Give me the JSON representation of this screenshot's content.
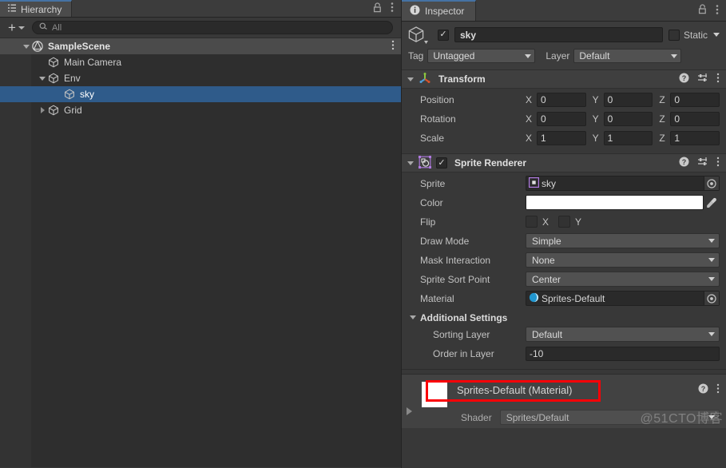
{
  "hierarchy": {
    "tab_label": "Hierarchy",
    "tab_icon": "hierarchy-icon",
    "lock_icon": "lock-icon",
    "menu_icon": "kebab-menu-icon",
    "create_label": "+",
    "search_placeholder": "All",
    "search_icon": "search-icon",
    "tree": [
      {
        "label": "SampleScene",
        "icon": "unity-scene-icon",
        "depth": 0,
        "expander": "down",
        "selected": false,
        "is_scene": true,
        "menu_icon": "kebab-menu-icon"
      },
      {
        "label": "Main Camera",
        "icon": "gameobject-cube-icon",
        "depth": 1,
        "expander": "none",
        "selected": false,
        "is_scene": false
      },
      {
        "label": "Env",
        "icon": "gameobject-cube-icon",
        "depth": 1,
        "expander": "down",
        "selected": false,
        "is_scene": false
      },
      {
        "label": "sky",
        "icon": "gameobject-cube-icon",
        "depth": 2,
        "expander": "none",
        "selected": true,
        "is_scene": false
      },
      {
        "label": "Grid",
        "icon": "gameobject-cube-icon",
        "depth": 1,
        "expander": "right",
        "selected": false,
        "is_scene": false
      }
    ]
  },
  "inspector": {
    "tab_label": "Inspector",
    "tab_icon": "info-circle-icon",
    "lock_icon": "lock-icon",
    "menu_icon": "kebab-menu-icon",
    "object": {
      "icon": "gameobject-cube-icon",
      "enabled": true,
      "name": "sky",
      "static_checked": false,
      "static_label": "Static",
      "tag_label": "Tag",
      "tag_value": "Untagged",
      "layer_label": "Layer",
      "layer_value": "Default"
    },
    "components": [
      {
        "title": "Transform",
        "icon": "transform-gizmo-icon",
        "expanded": true,
        "has_checkbox": false,
        "help_icon": "help-icon",
        "preset_icon": "preset-icon",
        "menu_icon": "kebab-menu-icon",
        "rows": [
          {
            "label": "Position",
            "axes": [
              {
                "axis": "X",
                "value": "0"
              },
              {
                "axis": "Y",
                "value": "0"
              },
              {
                "axis": "Z",
                "value": "0"
              }
            ]
          },
          {
            "label": "Rotation",
            "axes": [
              {
                "axis": "X",
                "value": "0"
              },
              {
                "axis": "Y",
                "value": "0"
              },
              {
                "axis": "Z",
                "value": "0"
              }
            ]
          },
          {
            "label": "Scale",
            "axes": [
              {
                "axis": "X",
                "value": "1"
              },
              {
                "axis": "Y",
                "value": "1"
              },
              {
                "axis": "Z",
                "value": "1"
              }
            ]
          }
        ]
      },
      {
        "title": "Sprite Renderer",
        "icon": "sprite-renderer-icon",
        "expanded": true,
        "has_checkbox": true,
        "checked": true,
        "help_icon": "help-icon",
        "preset_icon": "preset-icon",
        "menu_icon": "kebab-menu-icon"
      }
    ],
    "sprite_renderer": {
      "sprite_label": "Sprite",
      "sprite_value": "sky",
      "sprite_icon": "sprite-asset-icon",
      "color_label": "Color",
      "color_value": "#FFFFFF",
      "eyedropper_icon": "eyedropper-icon",
      "flip_label": "Flip",
      "flip_x_label": "X",
      "flip_y_label": "Y",
      "flip_x_checked": false,
      "flip_y_checked": false,
      "draw_mode_label": "Draw Mode",
      "draw_mode_value": "Simple",
      "mask_interaction_label": "Mask Interaction",
      "mask_interaction_value": "None",
      "sort_point_label": "Sprite Sort Point",
      "sort_point_value": "Center",
      "material_label": "Material",
      "material_value": "Sprites-Default",
      "material_icon": "material-sphere-icon",
      "additional_settings_label": "Additional Settings",
      "sorting_layer_label": "Sorting Layer",
      "sorting_layer_value": "Default",
      "order_in_layer_label": "Order in Layer",
      "order_in_layer_value": "-10"
    },
    "material_preview": {
      "title": "Sprites-Default (Material)",
      "swatch_color": "#FFFFFF",
      "shader_label": "Shader",
      "shader_value": "Sprites/Default",
      "help_icon": "help-icon",
      "menu_icon": "kebab-menu-icon"
    }
  },
  "annotation": {
    "highlight_color": "#FB0007",
    "highlight_target": "order-in-layer-row"
  },
  "watermark": {
    "text": "@51CTO博客"
  }
}
